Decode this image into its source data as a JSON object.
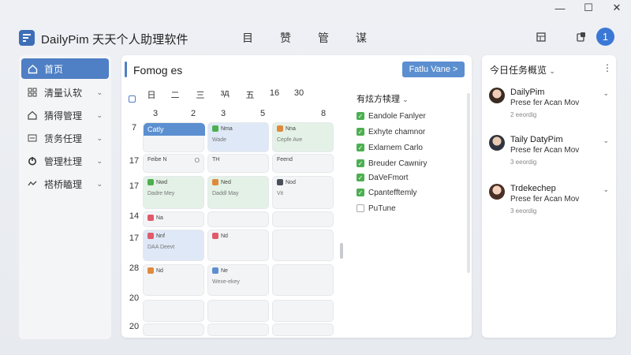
{
  "window": {
    "min": "—",
    "max": "☐",
    "close": "✕"
  },
  "app": {
    "title": "DailyPim 天天个人助理软件"
  },
  "top_nav": [
    "目",
    "赞",
    "管",
    "谋"
  ],
  "header_icons": {
    "calendar": "⊞",
    "notifications": "🗐",
    "badge": "1"
  },
  "sidebar": {
    "items": [
      {
        "label": "首页"
      },
      {
        "label": "清量认软"
      },
      {
        "label": "猜得管理"
      },
      {
        "label": "赁务任理"
      },
      {
        "label": "管理杜理"
      },
      {
        "label": "褡桥瞌理"
      }
    ]
  },
  "main": {
    "title": "Fomog es",
    "action_button": "Fatlu Vane  >",
    "weekdays": [
      "日",
      "二",
      "三",
      "зд",
      "五",
      "16",
      "30"
    ],
    "date_row": [
      "3",
      "2",
      "3",
      "5",
      "8"
    ],
    "row_labels": [
      "7",
      "17",
      "14",
      "17",
      "28",
      "20",
      "20"
    ],
    "cells": {
      "c1": {
        "title": "Catly"
      },
      "c2": {
        "title": "Nma",
        "sub": "Wade"
      },
      "c3": {
        "title": "Nna",
        "sub": "Cepfe Ave"
      },
      "c4": {
        "title": "Feibe N",
        "rt": "O"
      },
      "c5": {
        "title": "TH"
      },
      "c6": {
        "title": "Feend"
      },
      "c7": {
        "title": "Nwd",
        "sub": "Dadre Mey"
      },
      "c8": {
        "title": "Ned",
        "sub": "Daddl May"
      },
      "c9": {
        "title": "Nod",
        "sub": "Vit"
      },
      "c10": {
        "title": "Na"
      },
      "c11": {
        "title": "Nnf",
        "sub": "DAA Deevt"
      },
      "c12": {
        "title": "Nd"
      },
      "c13": {
        "title": "Nd"
      },
      "c14": {
        "title": "Ne",
        "sub": "Wexe-ekey"
      }
    }
  },
  "checklist": {
    "title": "有炫方犊理",
    "items": [
      {
        "label": "Eandole Fanlyer",
        "checked": true
      },
      {
        "label": "Exhyte chamnor",
        "checked": true
      },
      {
        "label": "Exlarnem Carlo",
        "checked": true
      },
      {
        "label": "Breuder Cawniry",
        "checked": true
      },
      {
        "label": "DaVeFmort",
        "checked": true
      },
      {
        "label": "Cpantefftemly",
        "checked": true
      },
      {
        "label": "PuTune",
        "checked": false
      }
    ]
  },
  "right_panel": {
    "title": "今日任务概览",
    "people": [
      {
        "name": "DailyPim",
        "line": "Prese fer Acan Mov",
        "meta": "2 eeordig"
      },
      {
        "name": "Taily DatyPim",
        "line": "Prese fer Acan Mov",
        "meta": "3 eeordig"
      },
      {
        "name": "Trdekechep",
        "line": "Prese fer Acan Mov",
        "meta": "3 eeordig"
      }
    ]
  },
  "colors": {
    "accent": "#4f7fc4",
    "check": "#4caf50"
  }
}
